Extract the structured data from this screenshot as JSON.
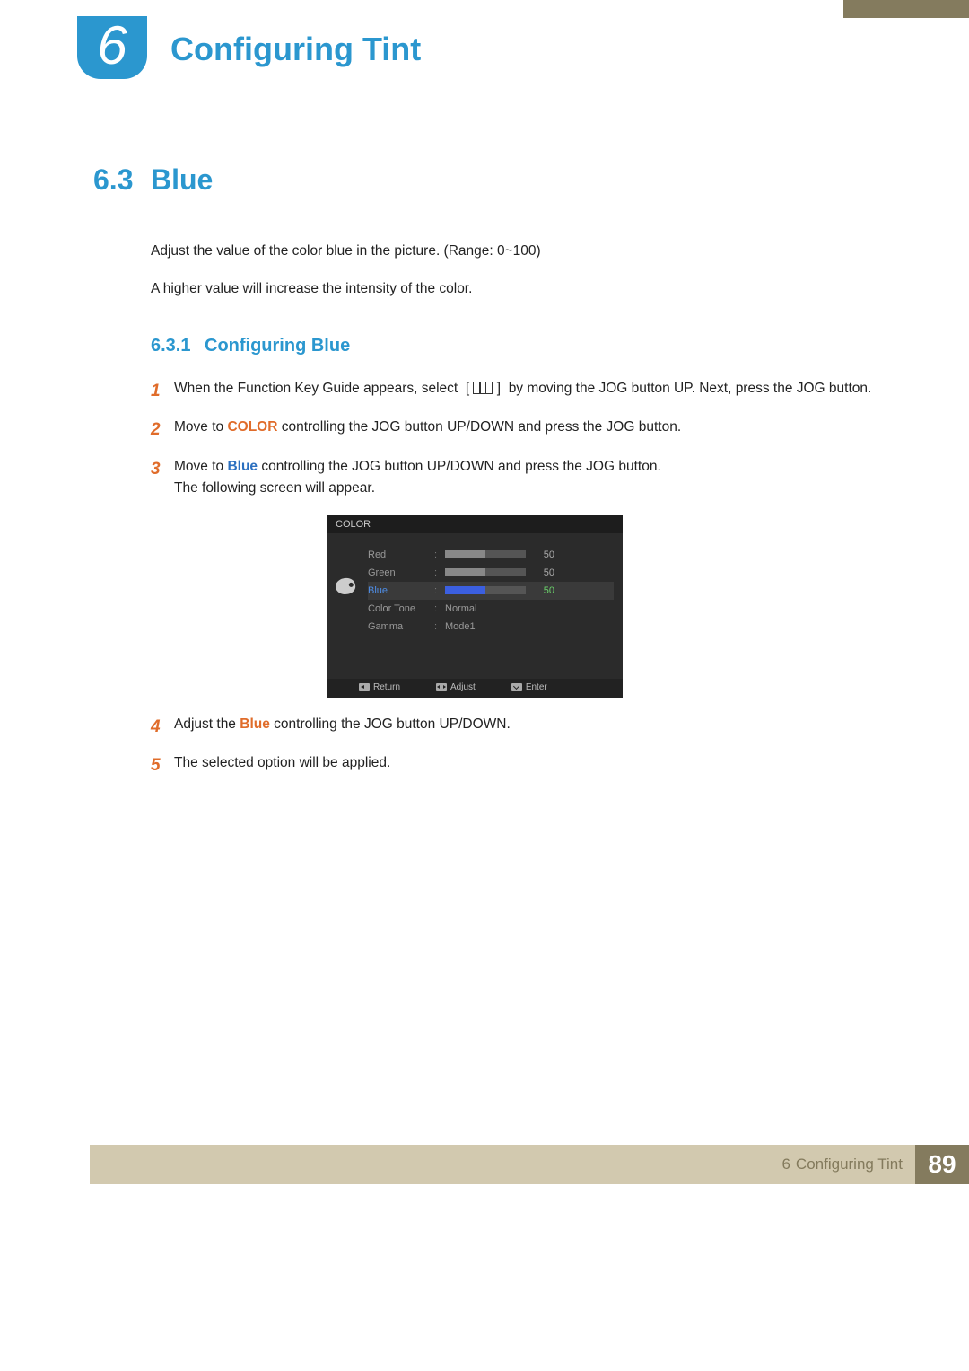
{
  "chapter": {
    "num": "6",
    "title": "Configuring Tint"
  },
  "section": {
    "num": "6.3",
    "title": "Blue"
  },
  "intro": {
    "p1": "Adjust the value of the color blue in the picture. (Range: 0~100)",
    "p2": "A higher value will increase the intensity of the color."
  },
  "subsection": {
    "num": "6.3.1",
    "title": "Configuring Blue"
  },
  "steps": {
    "s1a": "When the Function Key Guide appears, select",
    "s1b": "by moving the JOG button UP. Next, press the JOG button.",
    "s2a": "Move to ",
    "s2_color": "COLOR",
    "s2b": " controlling the JOG button UP/DOWN and press the JOG button.",
    "s3a": "Move to ",
    "s3_blue": "Blue",
    "s3b": " controlling the JOG button UP/DOWN and press the JOG button.",
    "s3c": "The following screen will appear.",
    "s4a": "Adjust the ",
    "s4_blue": "Blue",
    "s4b": " controlling the JOG button UP/DOWN.",
    "s5": "The selected option will be applied.",
    "n1": "1",
    "n2": "2",
    "n3": "3",
    "n4": "4",
    "n5": "5"
  },
  "osd": {
    "title": "COLOR",
    "rows": {
      "red": {
        "label": "Red",
        "val": "50"
      },
      "green": {
        "label": "Green",
        "val": "50"
      },
      "blue": {
        "label": "Blue",
        "val": "50"
      },
      "tone": {
        "label": "Color Tone",
        "val": "Normal"
      },
      "gamma": {
        "label": "Gamma",
        "val": "Mode1"
      }
    },
    "footer": {
      "return": "Return",
      "adjust": "Adjust",
      "enter": "Enter"
    }
  },
  "footer": {
    "chnum": "6",
    "title": "Configuring Tint",
    "page": "89"
  }
}
